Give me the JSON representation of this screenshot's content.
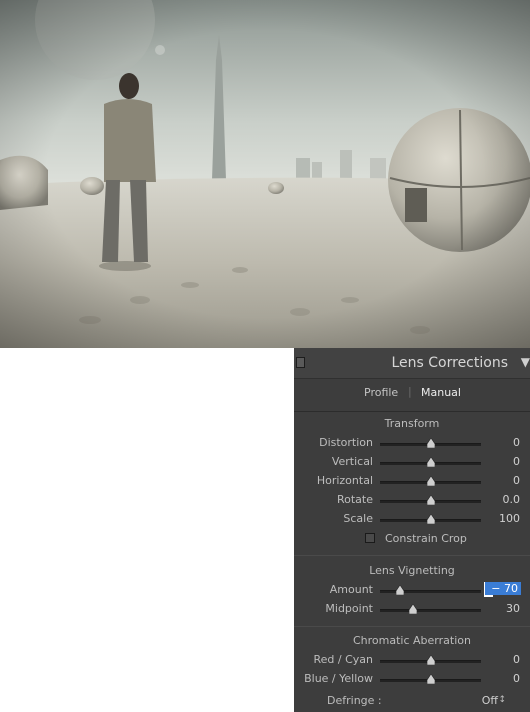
{
  "panel": {
    "title": "Lens Corrections",
    "tabs": [
      {
        "label": "Profile",
        "active": false
      },
      {
        "label": "Manual",
        "active": true
      }
    ],
    "transform": {
      "title": "Transform",
      "sliders": [
        {
          "label": "Distortion",
          "value": "0",
          "position": 0.5
        },
        {
          "label": "Vertical",
          "value": "0",
          "position": 0.5
        },
        {
          "label": "Horizontal",
          "value": "0",
          "position": 0.5
        },
        {
          "label": "Rotate",
          "value": "0.0",
          "position": 0.5
        },
        {
          "label": "Scale",
          "value": "100",
          "position": 0.5
        }
      ],
      "constrain_crop": {
        "label": "Constrain Crop",
        "checked": false
      }
    },
    "vignetting": {
      "title": "Lens Vignetting",
      "sliders": [
        {
          "label": "Amount",
          "value": "− 70",
          "position": 0.15,
          "selected": true
        },
        {
          "label": "Midpoint",
          "value": "30",
          "position": 0.3
        }
      ]
    },
    "chromatic": {
      "title": "Chromatic Aberration",
      "sliders": [
        {
          "label": "Red / Cyan",
          "value": "0",
          "position": 0.5
        },
        {
          "label": "Blue / Yellow",
          "value": "0",
          "position": 0.5
        }
      ],
      "defringe": {
        "label": "Defringe :",
        "value": "Off"
      }
    }
  },
  "colors": {
    "panel_bg": "#3d3d3d",
    "selection": "#3a7dd6",
    "photo_sky": "#d6dad4",
    "photo_sand": "#bcb9ad"
  },
  "icons": [
    "panel-collapse-square-icon",
    "collapse-triangle-icon",
    "slider-thumb-icon",
    "updown-arrows-icon"
  ]
}
